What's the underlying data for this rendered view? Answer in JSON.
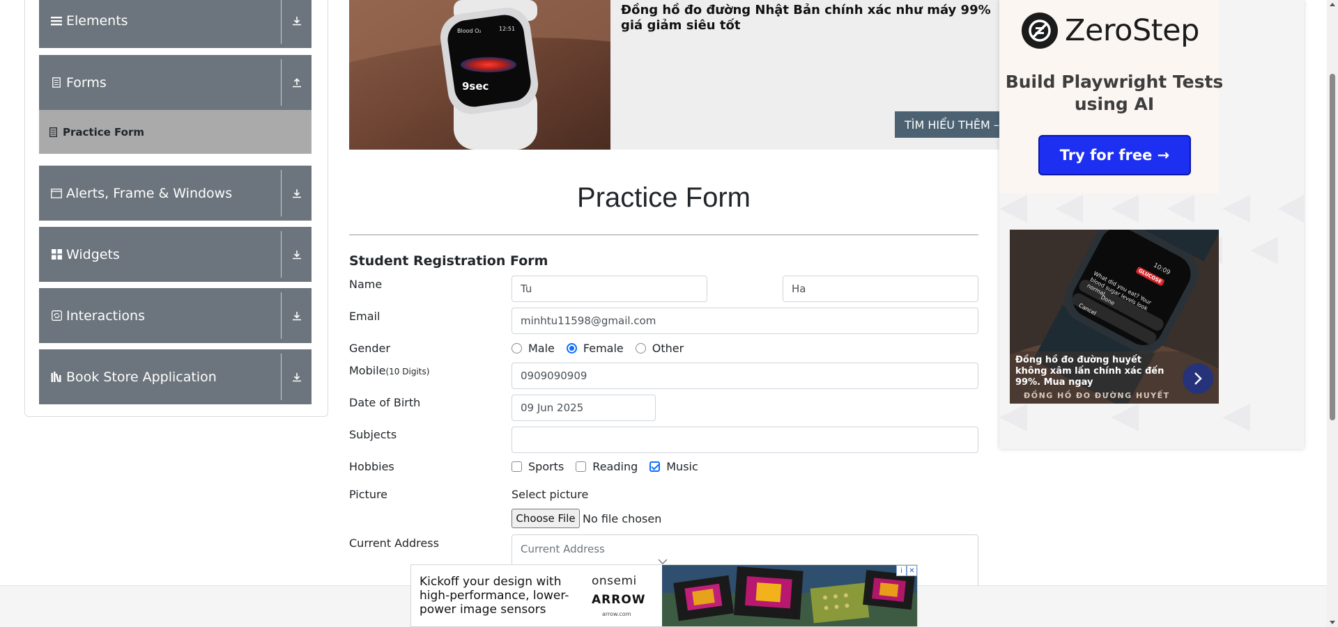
{
  "sidebar": {
    "groups": [
      {
        "label": "Elements",
        "icon": "hamburger-icon",
        "arrow": "download-icon"
      },
      {
        "label": "Forms",
        "icon": "document-icon",
        "arrow": "upload-icon"
      },
      {
        "label": "Alerts, Frame & Windows",
        "icon": "window-icon",
        "arrow": "download-icon"
      },
      {
        "label": "Widgets",
        "icon": "grid-icon",
        "arrow": "download-icon"
      },
      {
        "label": "Interactions",
        "icon": "refresh-icon",
        "arrow": "download-icon"
      },
      {
        "label": "Book Store Application",
        "icon": "books-icon",
        "arrow": "download-icon"
      }
    ],
    "active_item": {
      "label": "Practice Form",
      "icon": "form-icon"
    }
  },
  "top_ad": {
    "headline": "Đồng hồ đo đường Nhật Bản chính xác như máy 99% giá giảm siêu tốt",
    "cta": "TÌM HIỂU THÊM –",
    "watch_time": "12:51",
    "watch_title": "Blood O₂",
    "watch_counter": "9sec"
  },
  "right_ads": {
    "zerostep": {
      "brand": "ZeroStep",
      "tagline": "Build Playwright Tests using AI",
      "cta": "Try for free →"
    },
    "watch2": {
      "text": "Đồng hồ đo đường huyết không xâm lấn chính xác đến 99%. Mua ngay",
      "brand": "ĐỒNG HỒ ĐO ĐƯỜNG HUYẾT",
      "screen_time": "10:09",
      "screen_text": "What did you eat? Your blood sugar levels look normal.",
      "screen_badge": "GLUCOSE",
      "screen_buttons": [
        "Done",
        "Cancel"
      ]
    }
  },
  "form": {
    "page_title": "Practice Form",
    "heading": "Student Registration Form",
    "labels": {
      "name": "Name",
      "email": "Email",
      "gender": "Gender",
      "mobile": "Mobile",
      "mobile_hint": "(10 Digits)",
      "dob": "Date of Birth",
      "subjects": "Subjects",
      "hobbies": "Hobbies",
      "picture": "Picture",
      "address": "Current Address"
    },
    "first_name": "Tu",
    "last_name": "Ha",
    "email": "minhtu11598@gmail.com",
    "gender_options": [
      {
        "label": "Male",
        "checked": false
      },
      {
        "label": "Female",
        "checked": true
      },
      {
        "label": "Other",
        "checked": false
      }
    ],
    "mobile": "0909090909",
    "dob": "09 Jun 2025",
    "subjects": "",
    "hobbies": [
      {
        "label": "Sports",
        "checked": false
      },
      {
        "label": "Reading",
        "checked": false
      },
      {
        "label": "Music",
        "checked": true
      }
    ],
    "picture_label": "Select picture",
    "choose_file": "Choose File",
    "no_file": "No file chosen",
    "address_placeholder": "Current Address"
  },
  "bottom_ad": {
    "text": "Kickoff your design with high-performance, lower-power image sensors",
    "brand1": "onsemi",
    "brand2": "ARROW",
    "url": "arrow.com",
    "info": "i",
    "close": "✕"
  },
  "colors": {
    "sidebar_header": "#6c757d",
    "sidebar_active": "#aaaaaa",
    "accent": "#0d6efd",
    "zerostep_button": "#1d2ff0",
    "top_ad_cta": "#4c6272"
  }
}
